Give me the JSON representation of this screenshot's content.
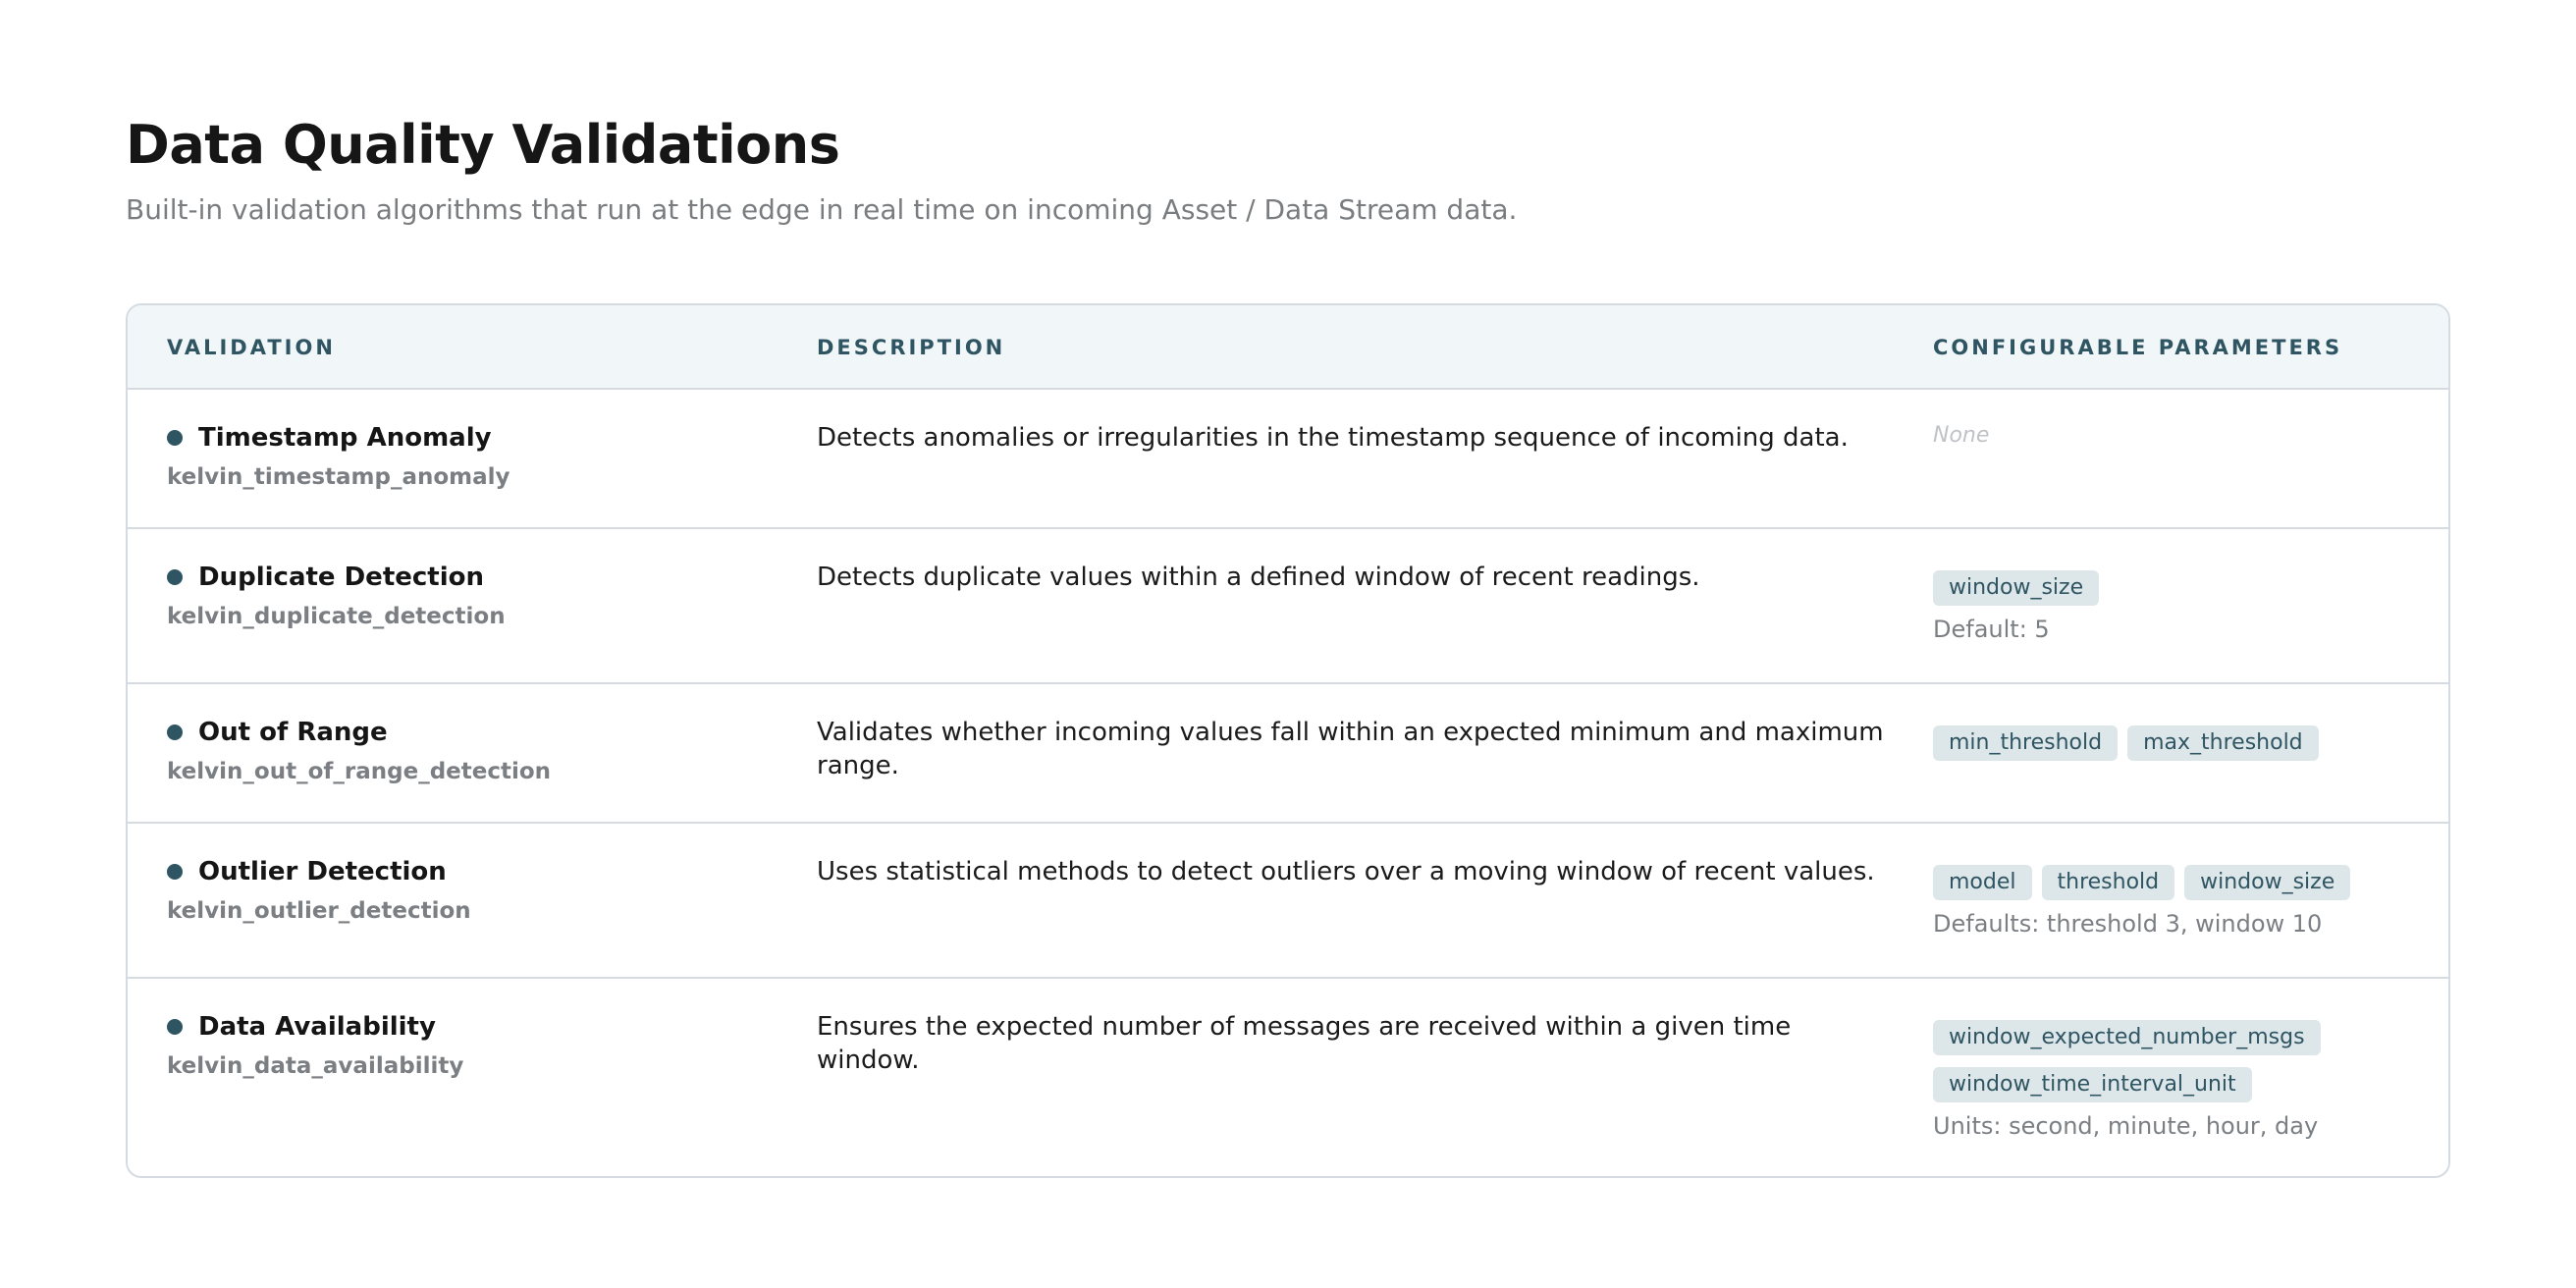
{
  "header": {
    "title": "Data Quality Validations",
    "subtitle": "Built-in validation algorithms that run at the edge in real time on incoming Asset / Data Stream data."
  },
  "table": {
    "columns": [
      "VALIDATION",
      "DESCRIPTION",
      "CONFIGURABLE PARAMETERS"
    ],
    "rows": [
      {
        "name": "Timestamp Anomaly",
        "id": "kelvin_timestamp_anomaly",
        "description": "Detects anomalies or irregularities in the timestamp sequence of incoming data.",
        "none_label": "None",
        "params": [],
        "note": ""
      },
      {
        "name": "Duplicate Detection",
        "id": "kelvin_duplicate_detection",
        "description": "Detects duplicate values within a defined window of recent readings.",
        "params": [
          "window_size"
        ],
        "note": "Default: 5"
      },
      {
        "name": "Out of Range",
        "id": "kelvin_out_of_range_detection",
        "description": "Validates whether incoming values fall within an expected minimum and maximum range.",
        "params": [
          "min_threshold",
          "max_threshold"
        ],
        "note": ""
      },
      {
        "name": "Outlier Detection",
        "id": "kelvin_outlier_detection",
        "description": "Uses statistical methods to detect outliers over a moving window of recent values.",
        "params": [
          "model",
          "threshold",
          "window_size"
        ],
        "note": "Defaults: threshold 3, window 10"
      },
      {
        "name": "Data Availability",
        "id": "kelvin_data_availability",
        "description": "Ensures the expected number of messages are received within a given time window.",
        "params": [
          "window_expected_number_msgs",
          "window_time_interval_unit"
        ],
        "note": "Units: second, minute, hour, day"
      }
    ]
  },
  "colors": {
    "accent": "#2f5563",
    "header_bg": "#f1f6f9",
    "chip_bg": "#dde6e9",
    "border": "#d6dbe2"
  }
}
